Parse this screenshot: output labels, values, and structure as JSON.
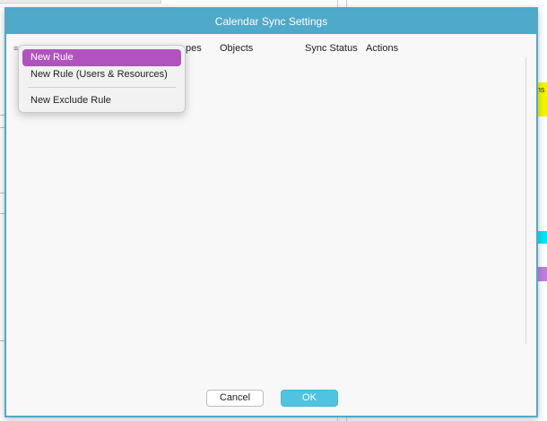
{
  "dialog": {
    "title": "Calendar Sync Settings"
  },
  "table": {
    "columns": {
      "type_partial": "pes",
      "objects": "Objects",
      "sync_status": "Sync Status",
      "actions": "Actions"
    }
  },
  "menu": {
    "items": [
      {
        "label": "New Rule",
        "selected": true
      },
      {
        "label": "New Rule (Users & Resources)",
        "selected": false
      },
      {
        "label": "New Exclude Rule",
        "selected": false
      }
    ]
  },
  "buttons": {
    "cancel": "Cancel",
    "ok": "OK"
  },
  "background": {
    "fragment_right": "ns"
  },
  "colors": {
    "titlebar": "#4fa9c9",
    "menu_selected": "#b153be",
    "ok_button": "#4fc3e0",
    "stripe_yellow": "#f5f500",
    "stripe_cyan": "#00e5f5",
    "stripe_purple": "#c27de0"
  }
}
